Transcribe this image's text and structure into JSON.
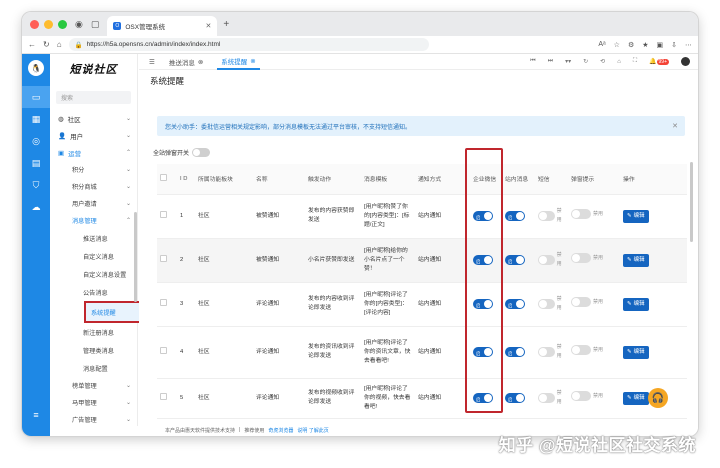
{
  "browser": {
    "tab_title": "OSX管理系统",
    "url": "https://h5a.opensns.cn/admin/index/index.html"
  },
  "sidebar": {
    "logo": "短说社区",
    "search_placeholder": "搜索",
    "items": [
      "社区",
      "用户",
      "运营"
    ],
    "sub_items": [
      "积分",
      "积分商城",
      "用户邀请",
      "消息管理"
    ],
    "subsub_items": [
      "推送消息",
      "自定义消息",
      "自定义消息设置",
      "公告消息",
      "系统提醒",
      "新注册消息",
      "管理类消息",
      "消息配置"
    ],
    "after_items": [
      "榜单管理",
      "马甲管理",
      "广告管理"
    ]
  },
  "main": {
    "tabs": [
      "推送消息",
      "系统提醒"
    ],
    "page_title": "系统提醒",
    "header_badge": "99+",
    "notice": "您关小助手：委批信运营相关规定影响，部分消息模板无法通过平台审核，不支持短信通知。",
    "global_switch_label": "全站弹窗开关",
    "columns": [
      "I D",
      "所属功能板块",
      "名称",
      "触发动作",
      "消息模板",
      "通知方式",
      "企业微信",
      "站内消息",
      "短信",
      "弹窗提示",
      "操作"
    ],
    "rows": [
      {
        "id": "1",
        "module": "社区",
        "name": "被赞通知",
        "action": "发布的内容获赞即发送",
        "template": "[用户昵称]赞了你的[内容类型]：[标题/正文]",
        "method": "站内通知"
      },
      {
        "id": "2",
        "module": "社区",
        "name": "被赞通知",
        "action": "小名片获赞即发送",
        "template": "[用户昵称]给你的小名片点了一个赞！",
        "method": "站内通知"
      },
      {
        "id": "3",
        "module": "社区",
        "name": "评论通知",
        "action": "发布的内容收到评论即发送",
        "template": "[用户昵称]评论了你的[内容类型]：[评论内容]",
        "method": "站内通知"
      },
      {
        "id": "4",
        "module": "社区",
        "name": "评论通知",
        "action": "发布的资讯收到评论即发送",
        "template": "[用户昵称]评论了你的资讯文章，快去看看吧!",
        "method": "站内通知"
      },
      {
        "id": "5",
        "module": "社区",
        "name": "评论通知",
        "action": "发布的视频收到评论即发送",
        "template": "[用户昵称]评论了你的视频，快去看看吧!",
        "method": "站内通知"
      }
    ],
    "toggle_on_text": "启",
    "toggle_off_text": "禁用",
    "edit_label": "编辑"
  },
  "footer": {
    "text": "本产品由惠天软件提供技术支持",
    "sep": "推荐使用",
    "browser_link": "奇虎浏览器",
    "tail": "说明 了解此页"
  },
  "watermark": "知乎 @短说社区社交系统"
}
